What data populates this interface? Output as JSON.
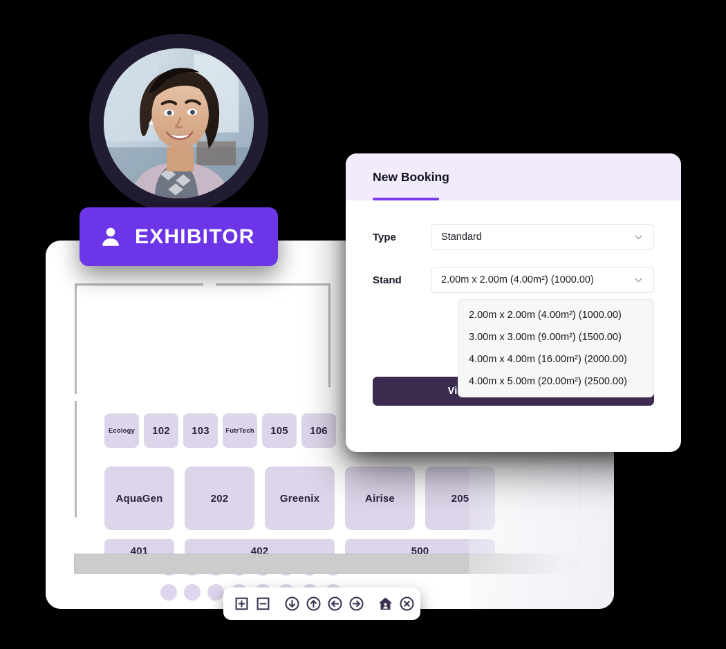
{
  "badge": {
    "label": "EXHIBITOR",
    "icon": "person-icon",
    "color": "#6d35e8"
  },
  "avatar": {
    "name": "exhibitor-avatar-photo",
    "alt": "Smiling woman portrait"
  },
  "panel": {
    "title": "New Booking",
    "accent_color": "#7c3aed",
    "header_bg": "#f1ebfd",
    "fields": [
      {
        "label": "Type",
        "value": "Standard",
        "icon": "chevron-down-icon"
      },
      {
        "label": "Stand",
        "value": "2.00m x 2.00m (4.00m²) (1000.00)",
        "icon": "chevron-down-icon"
      }
    ],
    "stand_options": [
      "2.00m x 2.00m (4.00m²) (1000.00)",
      "3.00m x 3.00m (9.00m²) (1500.00)",
      "4.00m x 4.00m (16.00m²) (2000.00)",
      "4.00m x 5.00m (20.00m²) (2500.00)"
    ],
    "cta_label": "View Interactive Floor Plan",
    "cta_color": "#3a2b4f"
  },
  "floorplan": {
    "seat_rows": 2,
    "seats_per_row": 8,
    "seat_color": "#ddd6ec",
    "stand_color": "#ddd5e9",
    "stands_row_small": [
      {
        "label": "Ecology",
        "kind": "named"
      },
      {
        "label": "102",
        "kind": "number"
      },
      {
        "label": "103",
        "kind": "number"
      },
      {
        "label": "FutrTech",
        "kind": "named"
      },
      {
        "label": "105",
        "kind": "number"
      },
      {
        "label": "106",
        "kind": "number"
      }
    ],
    "stands_row_med": [
      {
        "label": "AquaGen"
      },
      {
        "label": "202"
      },
      {
        "label": "Greenix"
      },
      {
        "label": "Airise"
      },
      {
        "label": "205"
      }
    ],
    "stands_row_wide": [
      {
        "label": "401"
      },
      {
        "label": "402"
      },
      {
        "label": "500"
      }
    ]
  },
  "toolbar": {
    "buttons": [
      {
        "name": "zoom-in-icon",
        "title": "Zoom in"
      },
      {
        "name": "zoom-out-icon",
        "title": "Zoom out"
      },
      {
        "name": "arrow-down-circle-icon",
        "title": "Pan down"
      },
      {
        "name": "arrow-up-circle-icon",
        "title": "Pan up"
      },
      {
        "name": "arrow-left-circle-icon",
        "title": "Pan left"
      },
      {
        "name": "arrow-right-circle-icon",
        "title": "Pan right"
      },
      {
        "name": "home-icon",
        "title": "Reset view"
      },
      {
        "name": "close-circle-icon",
        "title": "Close"
      }
    ]
  }
}
